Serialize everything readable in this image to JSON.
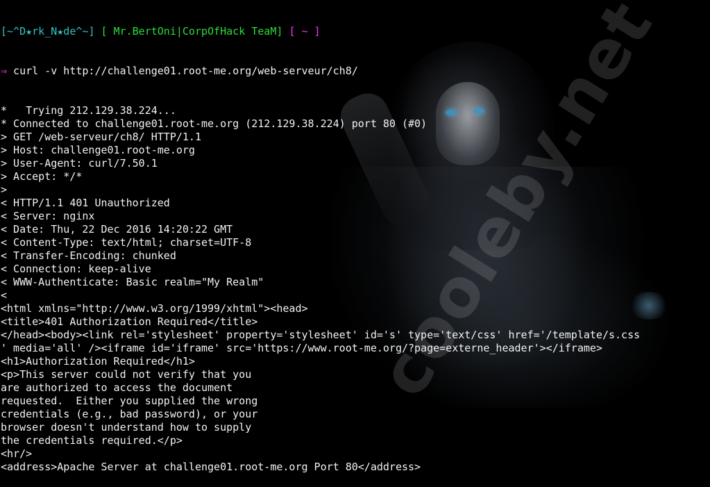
{
  "prompt": {
    "bracket_open": "[",
    "user": "~^D★rk_N★de^~",
    "bracket_close": "]",
    "team_open": "[",
    "team": "Mr.BertOni|CorpOfHack TeaM",
    "team_close": "]",
    "dir": "[ ~ ]",
    "arrow": "⇒"
  },
  "command": " curl -v http://challenge01.root-me.org/web-serveur/ch8/",
  "output_lines": [
    "*   Trying 212.129.38.224...",
    "* Connected to challenge01.root-me.org (212.129.38.224) port 80 (#0)",
    "> GET /web-serveur/ch8/ HTTP/1.1",
    "> Host: challenge01.root-me.org",
    "> User-Agent: curl/7.50.1",
    "> Accept: */*",
    ">",
    "< HTTP/1.1 401 Unauthorized",
    "< Server: nginx",
    "< Date: Thu, 22 Dec 2016 14:20:22 GMT",
    "< Content-Type: text/html; charset=UTF-8",
    "< Transfer-Encoding: chunked",
    "< Connection: keep-alive",
    "< WWW-Authenticate: Basic realm=\"My Realm\"",
    "<",
    "<html xmlns=\"http://www.w3.org/1999/xhtml\"><head>",
    "<title>401 Authorization Required</title>",
    "</head><body><link rel='stylesheet' property='stylesheet' id='s' type='text/css' href='/template/s.css",
    "' media='all' /><iframe id='iframe' src='https://www.root-me.org/?page=externe_header'></iframe>",
    "<h1>Authorization Required</h1>",
    "<p>This server could not verify that you",
    "are authorized to access the document",
    "requested.  Either you supplied the wrong",
    "credentials (e.g., bad password), or your",
    "browser doesn't understand how to supply",
    "the credentials required.</p>",
    "<hr/>",
    "<address>Apache Server at challenge01.root-me.org Port 80</address>"
  ],
  "watermark": "cooleby.net",
  "colors": {
    "text": "#f2f2f2",
    "prompt_user": "#37c3c3",
    "prompt_team": "#2ddd3a",
    "prompt_accent": "#ff33ff",
    "background": "#000000"
  }
}
